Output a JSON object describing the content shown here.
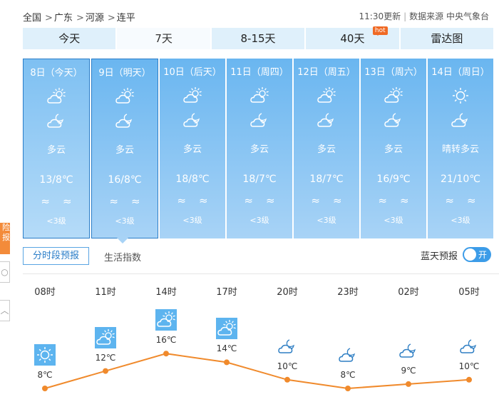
{
  "breadcrumb": {
    "items": [
      "全国",
      "广东",
      "河源",
      "连平"
    ],
    "sep": ">",
    "update": "11:30更新",
    "source": "数据来源 中央气象台"
  },
  "tabs": [
    {
      "label": "今天"
    },
    {
      "label": "7天",
      "active": true
    },
    {
      "label": "8-15天"
    },
    {
      "label": "40天",
      "badge": "hot"
    },
    {
      "label": "雷达图"
    }
  ],
  "days": [
    {
      "date": "8日（今天）",
      "weather": "多云",
      "temp": "13/8℃",
      "wind": "≈≈",
      "level": "<3级",
      "icon_day": "partly-cloudy-icon",
      "icon_night": "cloudy-night-icon"
    },
    {
      "date": "9日（明天）",
      "weather": "多云",
      "temp": "16/8℃",
      "wind": "≈≈",
      "level": "<3级",
      "icon_day": "partly-cloudy-icon",
      "icon_night": "cloudy-night-icon"
    },
    {
      "date": "10日（后天）",
      "weather": "多云",
      "temp": "18/8℃",
      "wind": "≈≈",
      "level": "<3级",
      "icon_day": "partly-cloudy-icon",
      "icon_night": "cloudy-night-icon"
    },
    {
      "date": "11日（周四）",
      "weather": "多云",
      "temp": "18/7℃",
      "wind": "≈≈",
      "level": "<3级",
      "icon_day": "partly-cloudy-icon",
      "icon_night": "cloudy-night-icon"
    },
    {
      "date": "12日（周五）",
      "weather": "多云",
      "temp": "18/7℃",
      "wind": "≈≈",
      "level": "<3级",
      "icon_day": "partly-cloudy-icon",
      "icon_night": "cloudy-night-icon"
    },
    {
      "date": "13日（周六）",
      "weather": "多云",
      "temp": "16/9℃",
      "wind": "≈≈",
      "level": "<3级",
      "icon_day": "partly-cloudy-icon",
      "icon_night": "cloudy-night-icon"
    },
    {
      "date": "14日（周日）",
      "weather": "晴转多云",
      "temp": "21/10℃",
      "wind": "≈≈",
      "level": "<3级",
      "icon_day": "sun-icon",
      "icon_night": "cloudy-night-icon"
    }
  ],
  "subtabs": {
    "hourly": "分时段预报",
    "life": "生活指数"
  },
  "bluesky": {
    "label": "蓝天预报",
    "toggle": "开"
  },
  "side": {
    "orange": "险 报"
  },
  "hourly": {
    "times": [
      "08时",
      "11时",
      "14时",
      "17时",
      "20时",
      "23时",
      "02时",
      "05时"
    ],
    "temps": [
      "8℃",
      "12℃",
      "16℃",
      "14℃",
      "10℃",
      "8℃",
      "9℃",
      "10℃"
    ],
    "values": [
      8,
      12,
      16,
      14,
      10,
      8,
      9,
      10
    ],
    "icons": [
      "sun-icon",
      "partly-cloudy-icon",
      "partly-cloudy-icon",
      "partly-cloudy-icon",
      "cloudy-night-icon",
      "cloudy-night-icon",
      "cloudy-night-icon",
      "cloudy-night-icon"
    ],
    "line_color": "#f08a2c"
  }
}
